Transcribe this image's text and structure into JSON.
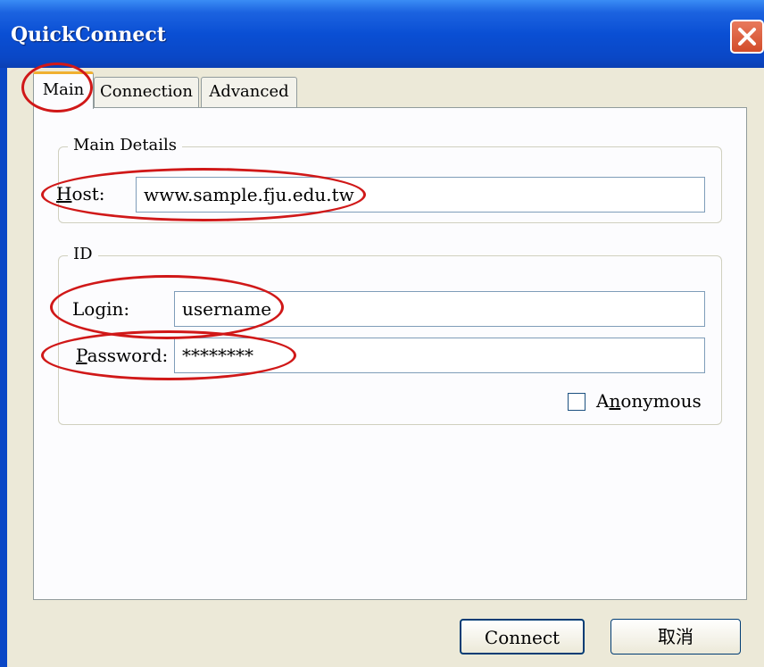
{
  "window": {
    "title": "QuickConnect"
  },
  "tabs": [
    {
      "label": "Main",
      "active": true
    },
    {
      "label": "Connection",
      "active": false
    },
    {
      "label": "Advanced",
      "active": false
    }
  ],
  "main_details": {
    "legend": "Main Details",
    "host_label_key": "H",
    "host_label_rest": "ost:",
    "host_value": "www.sample.fju.edu.tw"
  },
  "id_group": {
    "legend": "ID",
    "login_label_pre": "Lo",
    "login_label_key": "g",
    "login_label_rest": "in:",
    "login_value": "username",
    "password_label_key": "P",
    "password_label_rest": "assword:",
    "password_value": "********",
    "anonymous_label_pre": "A",
    "anonymous_label_key": "n",
    "anonymous_label_rest": "onymous",
    "anonymous_checked": false
  },
  "buttons": {
    "connect": "Connect",
    "cancel": "取消"
  },
  "colors": {
    "titlebar": "#0a4fd4",
    "annotation_circle": "#d01818",
    "tab_highlight": "#f0b030"
  }
}
